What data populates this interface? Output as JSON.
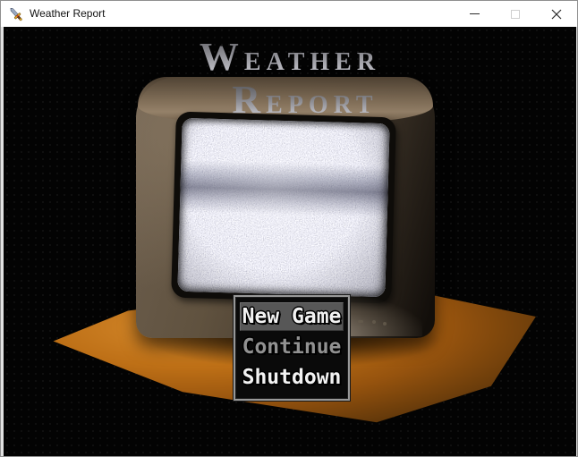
{
  "window": {
    "title": "Weather Report"
  },
  "titlebar": {
    "app_icon": "sword-icon",
    "minimize_label": "Minimize",
    "maximize_label": "Maximize",
    "close_label": "Close"
  },
  "game_title": {
    "line1": "Weather",
    "line2": "Report"
  },
  "scene": {
    "description_elements": [
      "crt-tv-static-screen",
      "wooden-table"
    ],
    "colors": {
      "background": "#030303",
      "table_wood": "#bd6f16",
      "tv_body": "#60523f",
      "static_light": "#cfd0df",
      "title_silver": "#a2a2a8"
    }
  },
  "menu": {
    "items": [
      {
        "label": "New Game",
        "state": "selected"
      },
      {
        "label": "Continue",
        "state": "disabled"
      },
      {
        "label": "Shutdown",
        "state": "normal"
      }
    ],
    "highlight_color": "#575757",
    "text_color": "#f2f2f2",
    "disabled_text_color": "#919191"
  }
}
